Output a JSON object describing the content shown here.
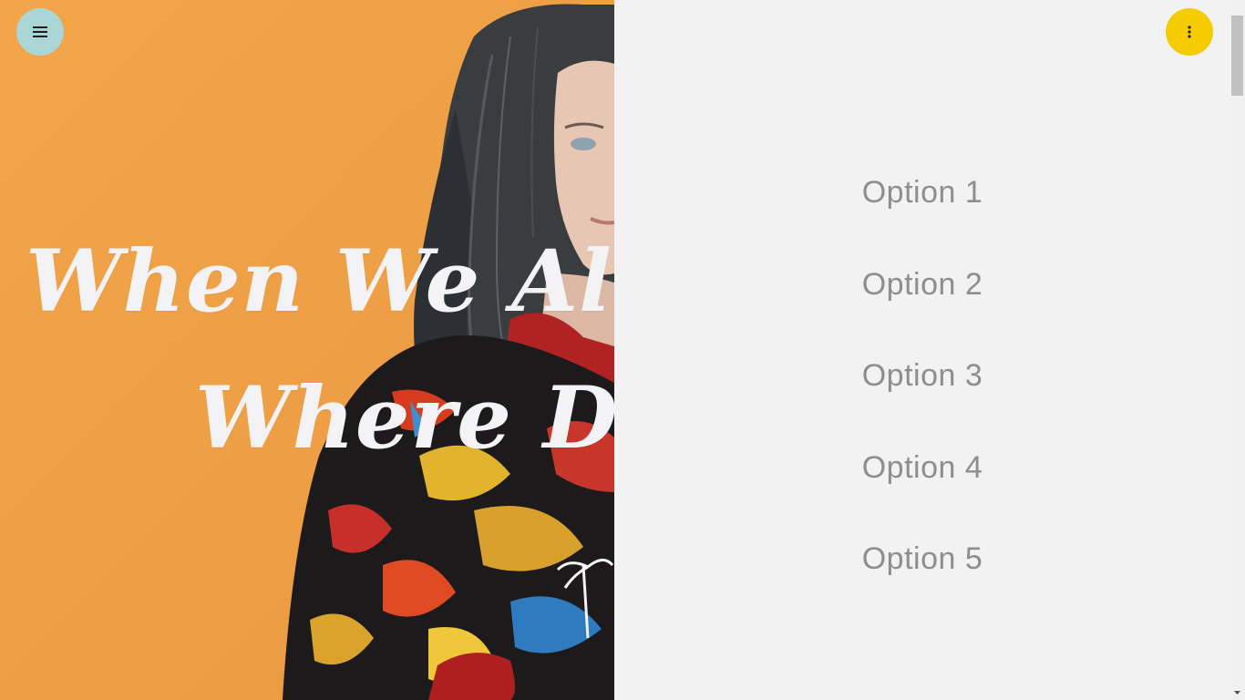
{
  "hero": {
    "title_line_1": "When We All",
    "title_line_2": "Where Do",
    "photo_icon": "portrait-photo"
  },
  "menu": {
    "items": [
      {
        "label": "Option 1"
      },
      {
        "label": "Option 2"
      },
      {
        "label": "Option 3"
      },
      {
        "label": "Option 4"
      },
      {
        "label": "Option 5"
      }
    ]
  },
  "buttons": {
    "menu_icon": "hamburger-icon",
    "more_icon": "more-vertical-icon"
  },
  "colors": {
    "hero_background": "#f0a347",
    "panel_background": "#f2f2f2",
    "menu_text": "#8e8e8e",
    "menu_button": "#abd6d6",
    "more_button": "#f4cc00",
    "title_text": "#f3f2f4"
  }
}
